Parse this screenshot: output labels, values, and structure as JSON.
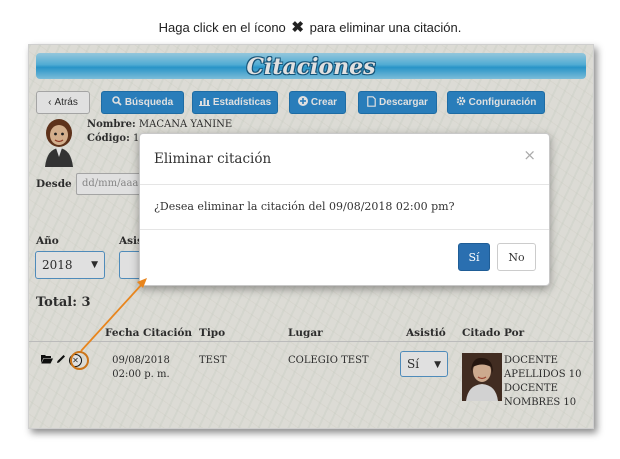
{
  "caption": {
    "before": "Haga click en el ícono",
    "x_symbol": "✖",
    "after": "para eliminar una citación."
  },
  "app": {
    "title": "Citaciones"
  },
  "toolbar": {
    "back": "Atrás",
    "search": "Búsqueda",
    "stats": "Estadísticas",
    "create": "Crear",
    "download": "Descargar",
    "config": "Configuración"
  },
  "student": {
    "name_label": "Nombre:",
    "name": "MACANA YANINE",
    "code_label": "Código:",
    "code": "10"
  },
  "filters": {
    "desde_label": "Desde",
    "date_placeholder": "dd/mm/aaaa",
    "year_label": "Año",
    "year_value": "2018",
    "asistio_label": "Asis"
  },
  "total": "Total: 3",
  "table": {
    "headers": [
      "Fecha Citación",
      "Tipo",
      "Lugar",
      "Asistió",
      "Citado Por"
    ],
    "row": {
      "date": "09/08/2018",
      "time": "02:00 p. m.",
      "type": "TEST",
      "place": "COLEGIO TEST",
      "attended": "Sí",
      "cited_by": [
        "DOCENTE",
        "APELLIDOS 10",
        "DOCENTE",
        "NOMBRES 10"
      ]
    }
  },
  "modal": {
    "title": "Eliminar citación",
    "close": "×",
    "body": "¿Desea eliminar la citación del 09/08/2018 02:00 pm?",
    "yes": "Sí",
    "no": "No"
  },
  "colors": {
    "primary": "#2f8fd4",
    "modal_primary": "#2a6fb0",
    "highlight": "#e8851d"
  }
}
